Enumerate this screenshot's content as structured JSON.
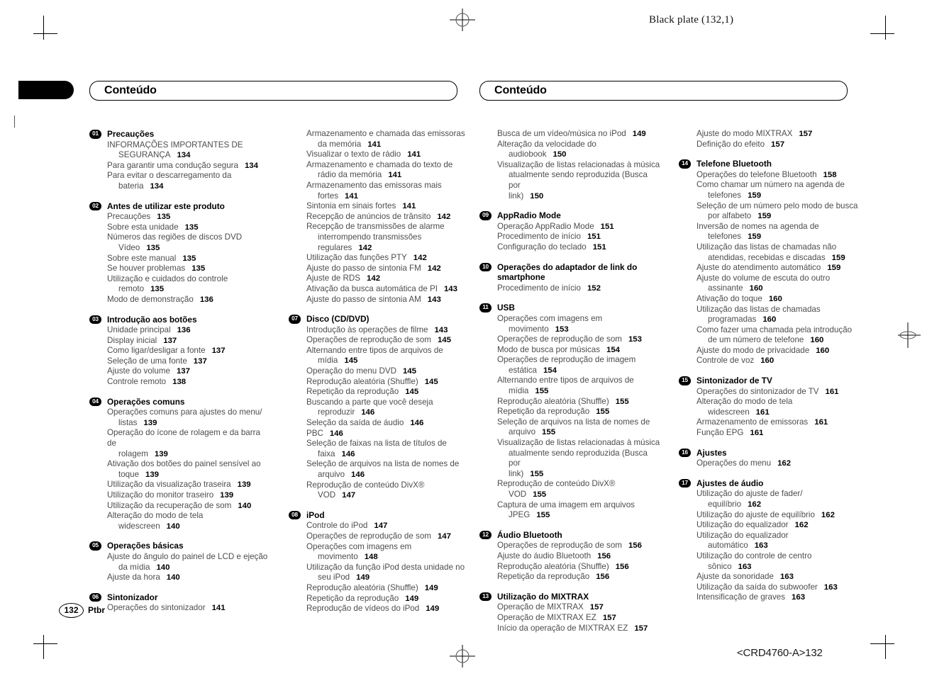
{
  "page": {
    "plate_label": "Black plate (132,1)",
    "folio": "132",
    "language_code": "Ptbr",
    "doc_id": "<CRD4760-A>132"
  },
  "headers": {
    "left_title": "Conteúdo",
    "right_title": "Conteúdo"
  },
  "columns": [
    {
      "id": "col1",
      "blocks": [
        {
          "type": "section",
          "number": "01",
          "title": "Precauções",
          "entries": [
            {
              "l1": "INFORMAÇÕES IMPORTANTES DE",
              "l2": "SEGURANÇA",
              "page": "134"
            },
            {
              "l1": "Para garantir uma condução segura",
              "page": "134"
            },
            {
              "l1": "Para evitar o descarregamento da",
              "l2": "bateria",
              "page": "134"
            }
          ]
        },
        {
          "type": "section",
          "number": "02",
          "title": "Antes de utilizar este produto",
          "entries": [
            {
              "l1": "Precauções",
              "page": "135"
            },
            {
              "l1": "Sobre esta unidade",
              "page": "135"
            },
            {
              "l1": "Números das regiões de discos DVD",
              "l2": "Vídeo",
              "page": "135"
            },
            {
              "l1": "Sobre este manual",
              "page": "135"
            },
            {
              "l1": "Se houver problemas",
              "page": "135"
            },
            {
              "l1": "Utilização e cuidados do controle",
              "l2": "remoto",
              "page": "135"
            },
            {
              "l1": "Modo de demonstração",
              "page": "136"
            }
          ]
        },
        {
          "type": "section",
          "number": "03",
          "title": "Introdução aos botões",
          "entries": [
            {
              "l1": "Unidade principal",
              "page": "136"
            },
            {
              "l1": "Display inicial",
              "page": "137"
            },
            {
              "l1": "Como ligar/desligar a fonte",
              "page": "137"
            },
            {
              "l1": "Seleção de uma fonte",
              "page": "137"
            },
            {
              "l1": "Ajuste do volume",
              "page": "137"
            },
            {
              "l1": "Controle remoto",
              "page": "138"
            }
          ]
        },
        {
          "type": "section",
          "number": "04",
          "title": "Operações comuns",
          "entries": [
            {
              "l1": "Operações comuns para ajustes do menu/",
              "l2": "listas",
              "page": "139"
            },
            {
              "l1": "Operação do ícone de rolagem e da barra de",
              "l2": "rolagem",
              "page": "139"
            },
            {
              "l1": "Ativação dos botões do painel sensível ao",
              "l2": "toque",
              "page": "139"
            },
            {
              "l1": "Utilização da visualização traseira",
              "page": "139"
            },
            {
              "l1": "Utilização do monitor traseiro",
              "page": "139"
            },
            {
              "l1": "Utilização da recuperação de som",
              "page": "140"
            },
            {
              "l1": "Alteração do modo de tela",
              "l2": "widescreen",
              "page": "140"
            }
          ]
        },
        {
          "type": "section",
          "number": "05",
          "title": "Operações básicas",
          "entries": [
            {
              "l1": "Ajuste do ângulo do painel de LCD e ejeção",
              "l2": "da mídia",
              "page": "140"
            },
            {
              "l1": "Ajuste da hora",
              "page": "140"
            }
          ]
        },
        {
          "type": "section",
          "number": "06",
          "title": "Sintonizador",
          "entries": [
            {
              "l1": "Operações do sintonizador",
              "page": "141"
            }
          ]
        }
      ]
    },
    {
      "id": "col2",
      "blocks": [
        {
          "type": "continuation",
          "entries": [
            {
              "l1": "Armazenamento e chamada das emissoras",
              "l2": "da memória",
              "page": "141"
            },
            {
              "l1": "Visualizar o texto de rádio",
              "page": "141"
            },
            {
              "l1": "Armazenamento e chamada do texto de",
              "l2": "rádio da memória",
              "page": "141"
            },
            {
              "l1": "Armazenamento das emissoras mais",
              "l2": "fortes",
              "page": "141"
            },
            {
              "l1": "Sintonia em sinais fortes",
              "page": "141"
            },
            {
              "l1": "Recepção de anúncios de trânsito",
              "page": "142"
            },
            {
              "l1": "Recepção de transmissões de alarme",
              "l2": "interrompendo transmissões",
              "l3": "regulares",
              "page": "142"
            },
            {
              "l1": "Utilização das funções PTY",
              "page": "142"
            },
            {
              "l1": "Ajuste do passo de sintonia FM",
              "page": "142"
            },
            {
              "l1": "Ajuste de RDS",
              "page": "142"
            },
            {
              "l1": "Ativação da busca automática de PI",
              "page": "143"
            },
            {
              "l1": "Ajuste do passo de sintonia AM",
              "page": "143"
            }
          ]
        },
        {
          "type": "section",
          "number": "07",
          "title": "Disco (CD/DVD)",
          "entries": [
            {
              "l1": "Introdução às operações de filme",
              "page": "143"
            },
            {
              "l1": "Operações de reprodução de som",
              "page": "145"
            },
            {
              "l1": "Alternando entre tipos de arquivos de",
              "l2": "mídia",
              "page": "145"
            },
            {
              "l1": "Operação do menu DVD",
              "page": "145"
            },
            {
              "l1": "Reprodução aleatória (Shuffle)",
              "page": "145"
            },
            {
              "l1": "Repetição da reprodução",
              "page": "145"
            },
            {
              "l1": "Buscando a parte que você deseja",
              "l2": "reproduzir",
              "page": "146"
            },
            {
              "l1": "Seleção da saída de áudio",
              "page": "146"
            },
            {
              "l1": "PBC",
              "page": "146"
            },
            {
              "l1": "Seleção de faixas na lista de títulos de",
              "l2": "faixa",
              "page": "146"
            },
            {
              "l1": "Seleção de arquivos na lista de nomes de",
              "l2": "arquivo",
              "page": "146"
            },
            {
              "l1": "Reprodução de conteúdo DivX®",
              "l2": "VOD",
              "page": "147"
            }
          ]
        },
        {
          "type": "section",
          "number": "08",
          "title": "iPod",
          "entries": [
            {
              "l1": "Controle do iPod",
              "page": "147"
            },
            {
              "l1": "Operações de reprodução de som",
              "page": "147"
            },
            {
              "l1": "Operações com imagens em",
              "l2": "movimento",
              "page": "148"
            },
            {
              "l1": "Utilização da função iPod desta unidade no",
              "l2": "seu iPod",
              "page": "149"
            },
            {
              "l1": "Reprodução aleatória (Shuffle)",
              "page": "149"
            },
            {
              "l1": "Repetição da reprodução",
              "page": "149"
            },
            {
              "l1": "Reprodução de vídeos do iPod",
              "page": "149"
            }
          ]
        }
      ]
    },
    {
      "id": "col3",
      "blocks": [
        {
          "type": "continuation",
          "entries": [
            {
              "l1": "Busca de um vídeo/música no iPod",
              "page": "149"
            },
            {
              "l1": "Alteração da velocidade do",
              "l2": "audiobook",
              "page": "150"
            },
            {
              "l1": "Visualização de listas relacionadas à música",
              "l2": "atualmente sendo reproduzida (Busca por",
              "l3": "link)",
              "page": "150"
            }
          ]
        },
        {
          "type": "section",
          "number": "09",
          "title": "AppRadio Mode",
          "entries": [
            {
              "l1": "Operação AppRadio Mode",
              "page": "151"
            },
            {
              "l1": "Procedimento de início",
              "page": "151"
            },
            {
              "l1": "Configuração do teclado",
              "page": "151"
            }
          ]
        },
        {
          "type": "section",
          "number": "10",
          "title": "Operações do adaptador de link do",
          "title2": "smartphone",
          "entries": [
            {
              "l1": "Procedimento de início",
              "page": "152"
            }
          ]
        },
        {
          "type": "section",
          "number": "11",
          "title": "USB",
          "entries": [
            {
              "l1": "Operações com imagens em",
              "l2": "movimento",
              "page": "153"
            },
            {
              "l1": "Operações de reprodução de som",
              "page": "153"
            },
            {
              "l1": "Modo de busca por músicas",
              "page": "154"
            },
            {
              "l1": "Operações de reprodução de imagem",
              "l2": "estática",
              "page": "154"
            },
            {
              "l1": "Alternando entre tipos de arquivos de",
              "l2": "mídia",
              "page": "155"
            },
            {
              "l1": "Reprodução aleatória (Shuffle)",
              "page": "155"
            },
            {
              "l1": "Repetição da reprodução",
              "page": "155"
            },
            {
              "l1": "Seleção de arquivos na lista de nomes de",
              "l2": "arquivo",
              "page": "155"
            },
            {
              "l1": "Visualização de listas relacionadas à música",
              "l2": "atualmente sendo reproduzida (Busca por",
              "l3": "link)",
              "page": "155"
            },
            {
              "l1": "Reprodução de conteúdo DivX®",
              "l2": "VOD",
              "page": "155"
            },
            {
              "l1": "Captura de uma imagem em arquivos",
              "l2": "JPEG",
              "page": "155"
            }
          ]
        },
        {
          "type": "section",
          "number": "12",
          "title": "Áudio Bluetooth",
          "entries": [
            {
              "l1": "Operações de reprodução de som",
              "page": "156"
            },
            {
              "l1": "Ajuste do áudio Bluetooth",
              "page": "156"
            },
            {
              "l1": "Reprodução aleatória (Shuffle)",
              "page": "156"
            },
            {
              "l1": "Repetição da reprodução",
              "page": "156"
            }
          ]
        },
        {
          "type": "section",
          "number": "13",
          "title": "Utilização do MIXTRAX",
          "entries": [
            {
              "l1": "Operação de MIXTRAX",
              "page": "157"
            },
            {
              "l1": "Operação de MIXTRAX EZ",
              "page": "157"
            },
            {
              "l1": "Início da operação de MIXTRAX EZ",
              "page": "157"
            }
          ]
        }
      ]
    },
    {
      "id": "col4",
      "blocks": [
        {
          "type": "continuation",
          "entries": [
            {
              "l1": "Ajuste do modo MIXTRAX",
              "page": "157"
            },
            {
              "l1": "Definição do efeito",
              "page": "157"
            }
          ]
        },
        {
          "type": "section",
          "number": "14",
          "title": "Telefone Bluetooth",
          "entries": [
            {
              "l1": "Operações do telefone Bluetooth",
              "page": "158"
            },
            {
              "l1": "Como chamar um número na agenda de",
              "l2": "telefones",
              "page": "159"
            },
            {
              "l1": "Seleção de um número pelo modo de busca",
              "l2": "por alfabeto",
              "page": "159"
            },
            {
              "l1": "Inversão de nomes na agenda de",
              "l2": "telefones",
              "page": "159"
            },
            {
              "l1": "Utilização das listas de chamadas não",
              "l2": "atendidas, recebidas e discadas",
              "page": "159"
            },
            {
              "l1": "Ajuste do atendimento automático",
              "page": "159"
            },
            {
              "l1": "Ajuste do volume de escuta do outro",
              "l2": "assinante",
              "page": "160"
            },
            {
              "l1": "Ativação do toque",
              "page": "160"
            },
            {
              "l1": "Utilização das listas de chamadas",
              "l2": "programadas",
              "page": "160"
            },
            {
              "l1": "Como fazer uma chamada pela introdução",
              "l2": "de um número de telefone",
              "page": "160"
            },
            {
              "l1": "Ajuste do modo de privacidade",
              "page": "160"
            },
            {
              "l1": "Controle de voz",
              "page": "160"
            }
          ]
        },
        {
          "type": "section",
          "number": "15",
          "title": "Sintonizador de TV",
          "entries": [
            {
              "l1": "Operações do sintonizador de TV",
              "page": "161"
            },
            {
              "l1": "Alteração do modo de tela",
              "l2": "widescreen",
              "page": "161"
            },
            {
              "l1": "Armazenamento de emissoras",
              "page": "161"
            },
            {
              "l1": "Função EPG",
              "page": "161"
            }
          ]
        },
        {
          "type": "section",
          "number": "16",
          "title": "Ajustes",
          "entries": [
            {
              "l1": "Operações do menu",
              "page": "162"
            }
          ]
        },
        {
          "type": "section",
          "number": "17",
          "title": "Ajustes de áudio",
          "entries": [
            {
              "l1": "Utilização do ajuste de fader/",
              "l2": "equilíbrio",
              "page": "162"
            },
            {
              "l1": "Utilização do ajuste de equilíbrio",
              "page": "162"
            },
            {
              "l1": "Utilização do equalizador",
              "page": "162"
            },
            {
              "l1": "Utilização do equalizador",
              "l2": "automático",
              "page": "163"
            },
            {
              "l1": "Utilização do controle de centro",
              "l2": "sônico",
              "page": "163"
            },
            {
              "l1": "Ajuste da sonoridade",
              "page": "163"
            },
            {
              "l1": "Utilização da saída do subwoofer",
              "page": "163"
            },
            {
              "l1": "Intensificação de graves",
              "page": "163"
            }
          ]
        }
      ]
    }
  ]
}
